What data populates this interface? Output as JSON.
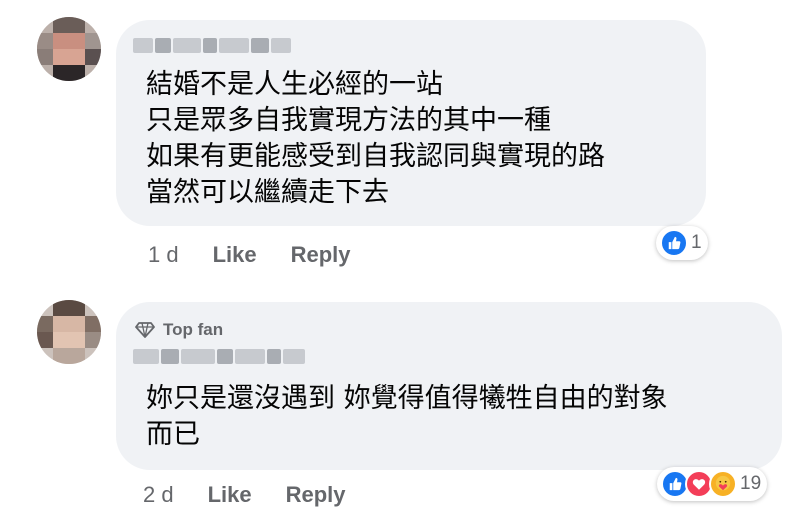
{
  "comments": [
    {
      "lines": [
        "結婚不是人生必經的一站",
        "只是眾多自我實現方法的其中一種",
        "如果有更能感受到自我認同與實現的路",
        "當然可以繼續走下去"
      ],
      "time": "1 d",
      "like_label": "Like",
      "reply_label": "Reply",
      "reaction_count": "1",
      "reaction_icons": [
        "like-icon"
      ]
    },
    {
      "badge": "Top fan",
      "badge_icon": "diamond-icon",
      "lines": [
        "妳只是還沒遇到 妳覺得值得犧牲自由的對象",
        "而已"
      ],
      "time": "2 d",
      "like_label": "Like",
      "reply_label": "Reply",
      "reaction_count": "19",
      "reaction_icons": [
        "like-icon",
        "love-icon",
        "care-icon"
      ]
    }
  ],
  "colors": {
    "bubble": "#f0f2f5",
    "text": "#050505",
    "meta": "#65676b",
    "like": "#1877f2",
    "love": "#f33e58",
    "care": "#f7b125"
  }
}
